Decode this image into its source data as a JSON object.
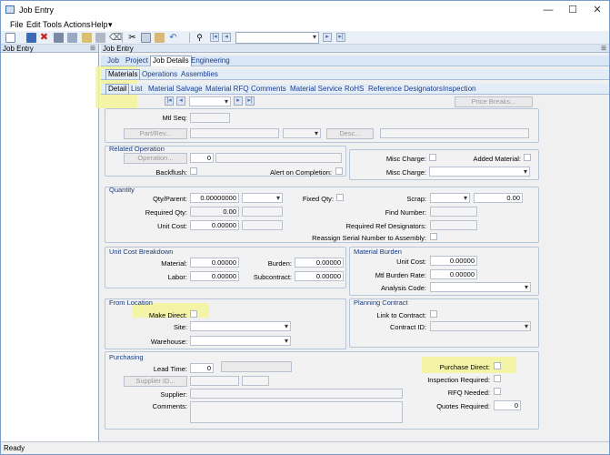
{
  "window": {
    "title": "Job Entry",
    "minimize": "—",
    "maximize": "☐",
    "close": "✕"
  },
  "menu": [
    "File",
    "Edit",
    "Tools",
    "Actions",
    "Help"
  ],
  "left_panel": {
    "title": "Job Entry"
  },
  "main_panel": {
    "title": "Job Entry"
  },
  "tabs_top": [
    "Job",
    "Project",
    "Job Details",
    "Engineering"
  ],
  "tabs_sub": [
    "Materials",
    "Operations",
    "Assemblies"
  ],
  "tabs_detail": [
    "Detail",
    "List",
    "Material Salvage",
    "Material RFQ",
    "Comments",
    "Material Service",
    "RoHS",
    "Reference Designators",
    "Inspection"
  ],
  "nav": {
    "price_breaks": "Price Breaks..."
  },
  "top_form": {
    "mtl_seq": "Mtl Seq:",
    "part_rev": "Part/Rev...",
    "desc": "Desc..."
  },
  "related_operation": {
    "title": "Related Operation",
    "operation": "Operation...",
    "operation_value": "0",
    "backflush": "Backflush:",
    "alert": "Alert on Completion:"
  },
  "misc": {
    "misc_charge": "Misc Charge:",
    "added_material": "Added Material:",
    "misc_charge2": "Misc Charge:"
  },
  "quantity": {
    "title": "Quantity",
    "qty_parent": "Qty/Parent:",
    "qty_parent_value": "0.00000000",
    "required_qty": "Required Qty:",
    "required_qty_value": "0.00",
    "unit_cost": "Unit Cost:",
    "unit_cost_value": "0.00000",
    "fixed_qty": "Fixed Qty:",
    "scrap": "Scrap:",
    "scrap_value": "0.00",
    "find_number": "Find Number:",
    "req_ref_des": "Required Ref Designators:",
    "reassign": "Reassign Serial Number to Assembly:"
  },
  "unit_cost_breakdown": {
    "title": "Unit Cost Breakdown",
    "material": "Material:",
    "material_value": "0.00000",
    "labor": "Labor:",
    "labor_value": "0.00000",
    "burden": "Burden:",
    "burden_value": "0.00000",
    "subcontract": "Subcontract:",
    "subcontract_value": "0.00000"
  },
  "material_burden": {
    "title": "Material Burden",
    "unit_cost": "Unit Cost:",
    "unit_cost_value": "0.00000",
    "mtl_burden_rate": "Mtl  Burden Rate:",
    "mtl_burden_rate_value": "0.00000",
    "analysis_code": "Analysis Code:"
  },
  "from_location": {
    "title": "From Location",
    "make_direct": "Make Direct:",
    "site": "Site:",
    "warehouse": "Warehouse:"
  },
  "planning_contract": {
    "title": "Planning Contract",
    "link_to_contract": "Link to Contract:",
    "contract_id": "Contract ID:"
  },
  "purchasing": {
    "title": "Purchasing",
    "lead_time": "Lead Time:",
    "lead_time_value": "0",
    "supplier_id": "Supplier ID...",
    "supplier": "Supplier:",
    "comments": "Comments:",
    "purchase_direct": "Purchase Direct:",
    "inspection_required": "Inspection  Required:",
    "rfq_needed": "RFQ Needed:",
    "quotes_required": "Quotes Required:",
    "quotes_required_value": "0"
  },
  "status": {
    "text": "Ready"
  },
  "colors": {
    "highlight": "#f4f49a",
    "tab_bg": "#d9e6f5",
    "group_title": "#1a3a7c"
  }
}
